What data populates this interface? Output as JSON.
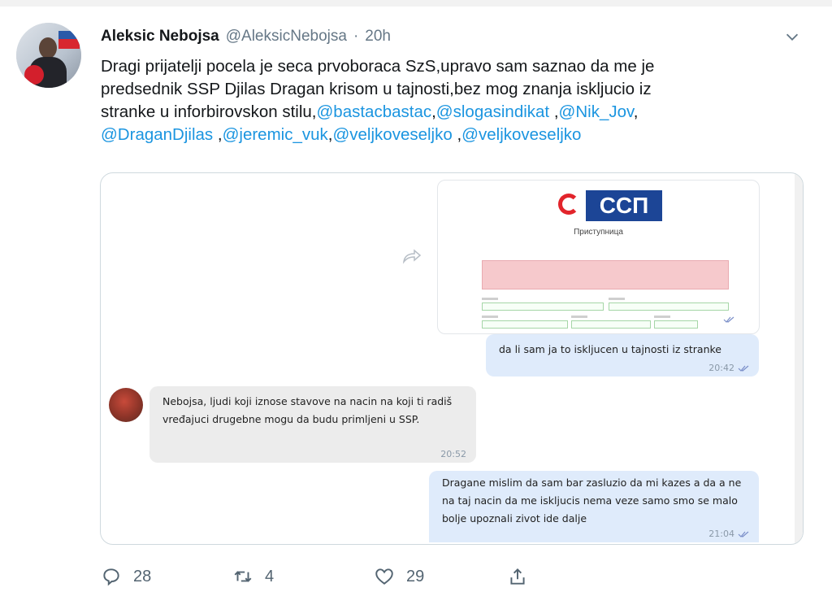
{
  "author": {
    "name": "Aleksic Nebojsa",
    "handle": "@AleksicNebojsa",
    "separator": "·",
    "time": "20h"
  },
  "tweet": {
    "text_lines": [
      "Dragi prijatelji pocela je seca prvoboraca SzS,upravo sam saznao da me je",
      "predsednik SSP Djilas Dragan krisom u tajnosti,bez mog znanja iskljucio iz",
      "stranke u inforbirovskon stilu,"
    ],
    "mentions": [
      "@bastacbastac",
      "@slogasindikat",
      "@Nik_Jov",
      "@DraganDjilas",
      "@jeremic_vuk",
      "@veljkoveseljko",
      "@veljkoveseljko"
    ]
  },
  "media": {
    "screenshot_logo_text": "ССП",
    "screenshot_form_title": "Приступница",
    "messages": [
      {
        "text": "da li sam ja to iskljucen u tajnosti iz stranke",
        "time": "20:42"
      },
      {
        "text": "Nebojsa, ljudi koji iznose stavove na nacin na koji ti radiš vređajuci drugebne mogu da budu primljeni u SSP.",
        "time": "20:52"
      },
      {
        "text": "Dragane mislim da sam bar zasluzio da mi kazes a da a ne na taj nacin da me iskljucis nema veze samo smo se malo bolje upoznali zivot ide dalje",
        "time": "21:04"
      }
    ]
  },
  "actions": {
    "replies": "28",
    "retweets": "4",
    "likes": "29"
  },
  "colors": {
    "link": "#1b95e0",
    "outgoing_bubble": "#dfebfb",
    "incoming_bubble": "#ececec"
  }
}
